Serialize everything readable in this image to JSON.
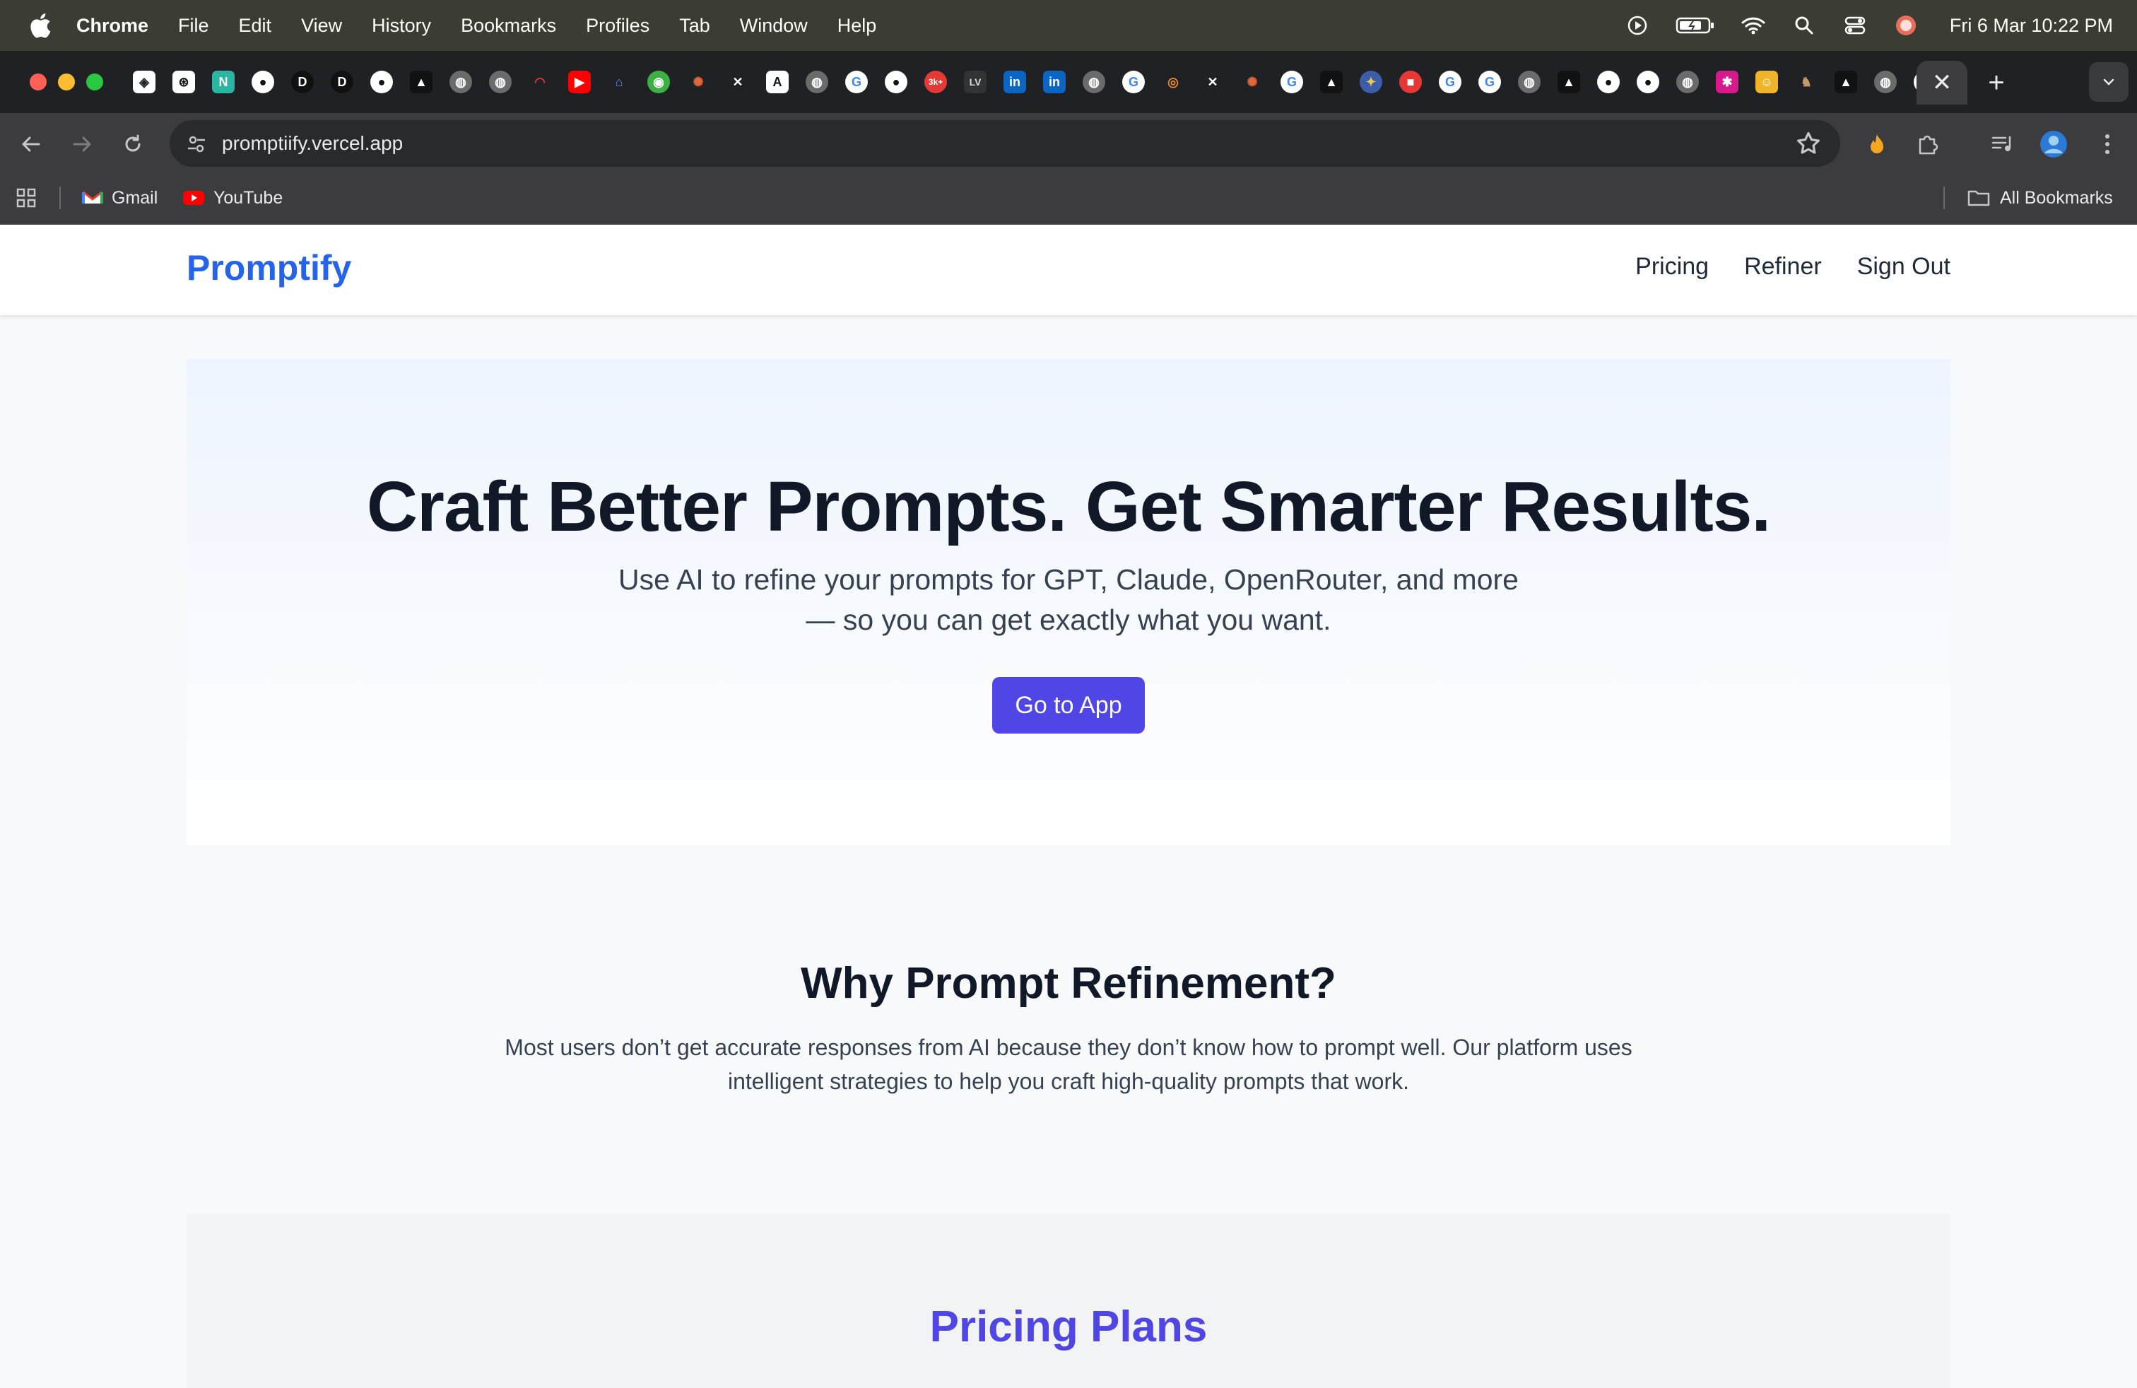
{
  "menubar": {
    "app_name": "Chrome",
    "menus": [
      "File",
      "Edit",
      "View",
      "History",
      "Bookmarks",
      "Profiles",
      "Tab",
      "Window",
      "Help"
    ],
    "clock": "Fri 6 Mar  10:22 PM"
  },
  "browser": {
    "url": "promptiify.vercel.app",
    "bookmarks": [
      {
        "label": "Gmail",
        "icon": "gmail-icon"
      },
      {
        "label": "YouTube",
        "icon": "youtube-icon"
      }
    ],
    "all_bookmarks": "All Bookmarks",
    "new_tab": "+",
    "close_tab": "✕"
  },
  "site": {
    "brand": "Promptify",
    "nav": {
      "pricing": "Pricing",
      "refiner": "Refiner",
      "signout": "Sign Out"
    }
  },
  "hero": {
    "title": "Craft Better Prompts. Get Smarter Results.",
    "subtitle_line1": "Use AI to refine your prompts for GPT, Claude, OpenRouter, and more",
    "subtitle_line2": "— so you can get exactly what you want.",
    "cta": "Go to App"
  },
  "why": {
    "title": "Why Prompt Refinement?",
    "line1": "Most users don’t get accurate responses from AI because they don’t know how to prompt well. Our platform uses",
    "line2": "intelligent strategies to help you craft high-quality prompts that work."
  },
  "pricing": {
    "title": "Pricing Plans"
  },
  "colors": {
    "brand_blue": "#2563eb",
    "cta_indigo": "#4f46e5",
    "chrome_dark": "#202124"
  }
}
